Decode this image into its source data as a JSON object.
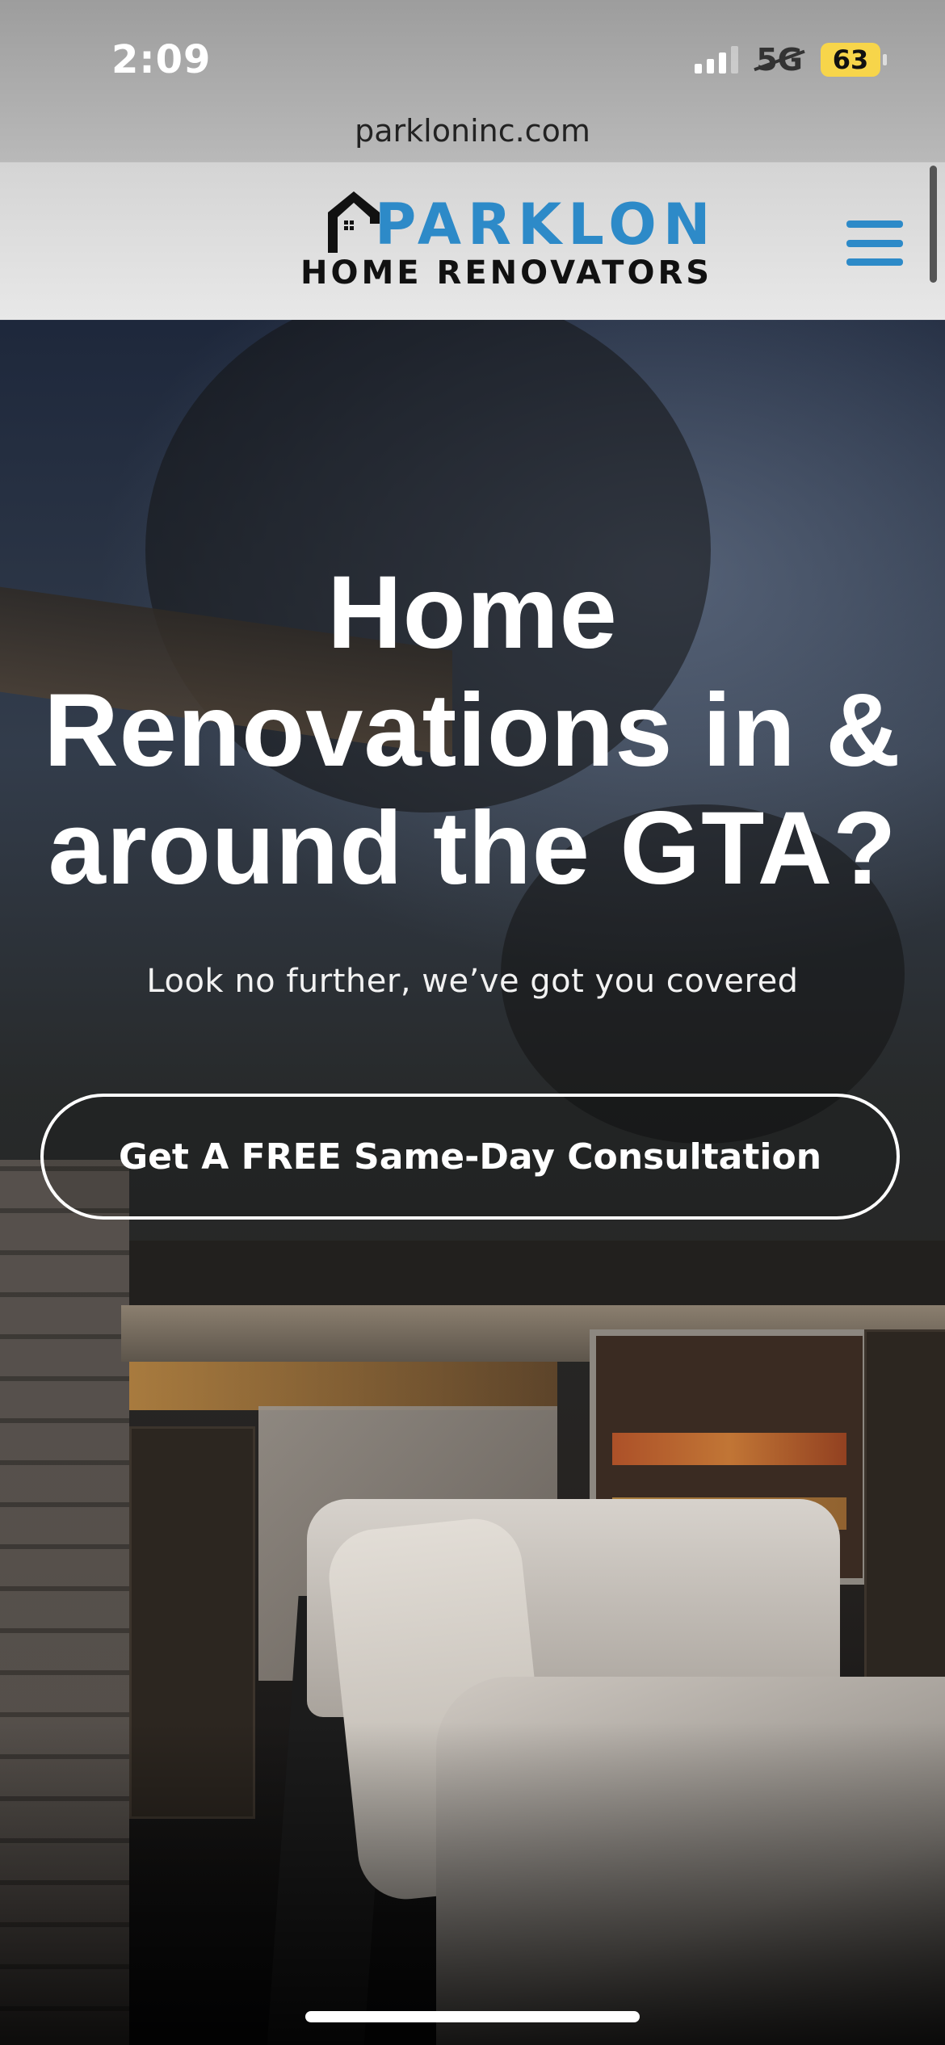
{
  "status_bar": {
    "time": "2:09",
    "network": "5G",
    "battery": "63"
  },
  "browser": {
    "url": "parkloninc.com"
  },
  "header": {
    "logo_top": "PARKLON",
    "logo_bottom": "HOME RENOVATORS",
    "brand_color": "#2d8ac8"
  },
  "hero": {
    "title_line1": "Home",
    "title_line2": "Renovations in &",
    "title_line3": "around the GTA?",
    "subtitle": "Look no further, we’ve got you covered",
    "cta_label": "Get A FREE Same-Day Consultation"
  },
  "icons": {
    "menu": "hamburger-menu-icon",
    "logo_mark": "house-icon"
  }
}
